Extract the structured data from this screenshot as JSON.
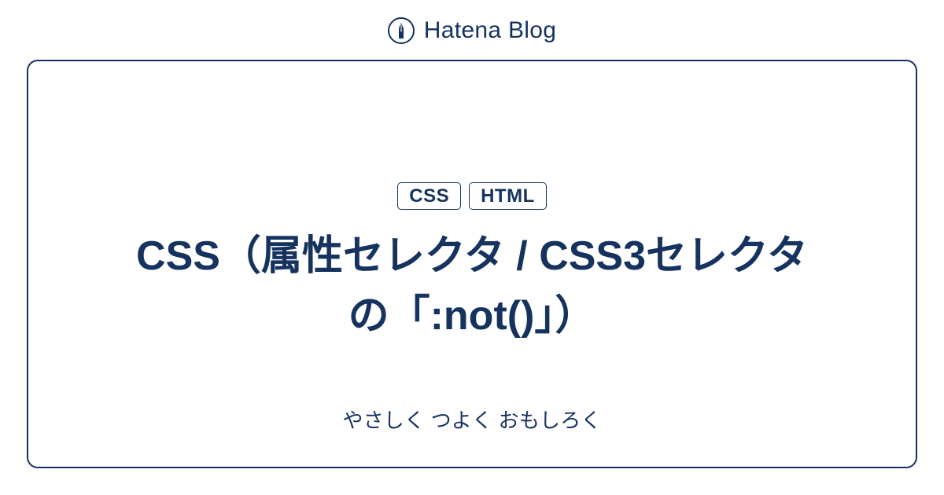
{
  "header": {
    "brand": "Hatena Blog",
    "icon": "pen-icon"
  },
  "card": {
    "tags": [
      "CSS",
      "HTML"
    ],
    "title": "CSS（属性セレクタ / CSS3セレクタの「:not()」）",
    "subtitle": "やさしく つよく おもしろく"
  }
}
